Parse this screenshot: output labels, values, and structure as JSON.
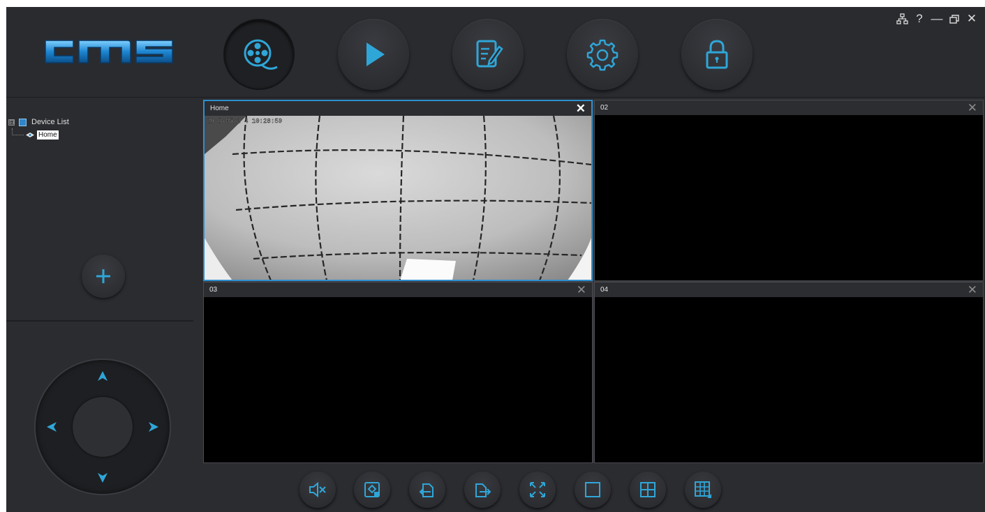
{
  "app": {
    "logo_text": "cms",
    "accent_color": "#2fa6d8"
  },
  "nav": {
    "buttons": [
      {
        "name": "live-view",
        "icon": "film-reel-icon",
        "active": true
      },
      {
        "name": "playback",
        "icon": "play-icon",
        "active": false
      },
      {
        "name": "log",
        "icon": "edit-document-icon",
        "active": false
      },
      {
        "name": "settings",
        "icon": "gear-icon",
        "active": false
      },
      {
        "name": "lock",
        "icon": "lock-icon",
        "active": false
      }
    ]
  },
  "window_controls": [
    {
      "icon": "network-icon"
    },
    {
      "icon": "help-icon",
      "label": "?"
    },
    {
      "icon": "minimize-icon",
      "label": "—"
    },
    {
      "icon": "restore-icon"
    },
    {
      "icon": "close-icon",
      "label": "✕"
    }
  ],
  "device_tree": {
    "root_label": "Device List",
    "expander": "⊟",
    "children": [
      {
        "label": "Home",
        "selected": true
      }
    ]
  },
  "ptz": {
    "directions": [
      "up",
      "left",
      "right",
      "down"
    ]
  },
  "panes": [
    {
      "title": "Home",
      "close": "✕",
      "selected": true,
      "osd": "20 8-05-2 4    10:28:59"
    },
    {
      "title": "02",
      "close": "✕",
      "selected": false
    },
    {
      "title": "03",
      "close": "✕",
      "selected": false
    },
    {
      "title": "04",
      "close": "✕",
      "selected": false
    }
  ],
  "toolbar": {
    "buttons": [
      {
        "icon": "mute-icon"
      },
      {
        "icon": "snapshot-icon"
      },
      {
        "icon": "import-icon"
      },
      {
        "icon": "export-icon"
      },
      {
        "icon": "fullscreen-icon"
      },
      {
        "icon": "single-view-icon"
      },
      {
        "icon": "quad-view-icon"
      },
      {
        "icon": "multi-view-icon"
      }
    ]
  }
}
